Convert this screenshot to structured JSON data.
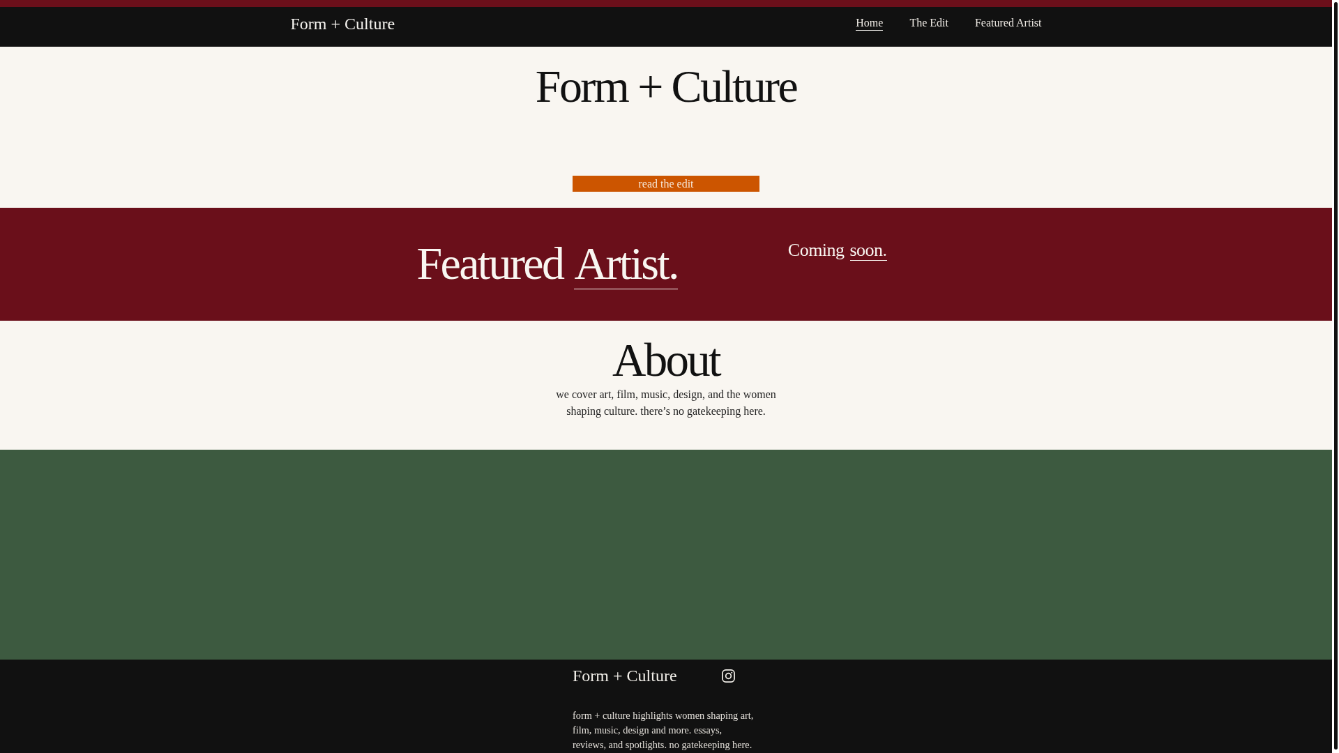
{
  "nav": {
    "brand": "Form + Culture",
    "links": [
      {
        "label": "Home",
        "selected": true
      },
      {
        "label": "The Edit",
        "selected": false
      },
      {
        "label": "Featured Artist",
        "selected": false
      }
    ]
  },
  "hero": {
    "title": "Form + Culture",
    "button": "read the edit"
  },
  "featured": {
    "heading": {
      "text": "Featured",
      "link": "Artist."
    },
    "note": {
      "text": "Coming",
      "link": "soon."
    }
  },
  "about": {
    "title": "About",
    "text": "we cover art, film, music, design, and the women shaping culture. there’s no gatekeeping here."
  },
  "footer": {
    "brand": "Form + Culture",
    "text": "form + culture highlights women shaping art, film, music, design and more. essays, reviews, and spotlights. no gatekeeping here."
  }
}
